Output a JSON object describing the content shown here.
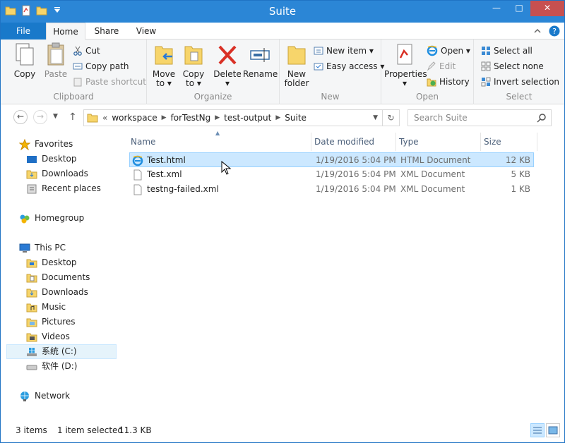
{
  "window": {
    "title": "Suite"
  },
  "tabs": {
    "file": "File",
    "home": "Home",
    "share": "Share",
    "view": "View"
  },
  "ribbon": {
    "clipboard": {
      "label": "Clipboard",
      "copy": "Copy",
      "paste": "Paste",
      "cut": "Cut",
      "copy_path": "Copy path",
      "paste_shortcut": "Paste shortcut"
    },
    "organize": {
      "label": "Organize",
      "move_to_1": "Move",
      "move_to_2": "to ▾",
      "copy_to_1": "Copy",
      "copy_to_2": "to ▾",
      "delete_1": "Delete",
      "delete_2": "▾",
      "rename": "Rename"
    },
    "new": {
      "label": "New",
      "new_folder_1": "New",
      "new_folder_2": "folder",
      "new_item": "New item ▾",
      "easy_access": "Easy access ▾"
    },
    "open": {
      "label": "Open",
      "properties_1": "Properties",
      "properties_2": "▾",
      "open": "Open ▾",
      "edit": "Edit",
      "history": "History"
    },
    "select": {
      "label": "Select",
      "select_all": "Select all",
      "select_none": "Select none",
      "invert": "Invert selection"
    }
  },
  "address": {
    "prefix": "«",
    "crumbs": [
      "workspace",
      "forTestNg",
      "test-output",
      "Suite"
    ],
    "search_placeholder": "Search Suite"
  },
  "nav": {
    "favorites": "Favorites",
    "fav_items": [
      "Desktop",
      "Downloads",
      "Recent places"
    ],
    "homegroup": "Homegroup",
    "thispc": "This PC",
    "pc_items": [
      "Desktop",
      "Documents",
      "Downloads",
      "Music",
      "Pictures",
      "Videos",
      "系统 (C:)",
      "软件 (D:)"
    ],
    "network": "Network"
  },
  "columns": {
    "name": "Name",
    "date": "Date modified",
    "type": "Type",
    "size": "Size"
  },
  "files": [
    {
      "name": "Test.html",
      "date": "1/19/2016 5:04 PM",
      "type": "HTML Document",
      "size": "12 KB"
    },
    {
      "name": "Test.xml",
      "date": "1/19/2016 5:04 PM",
      "type": "XML Document",
      "size": "5 KB"
    },
    {
      "name": "testng-failed.xml",
      "date": "1/19/2016 5:04 PM",
      "type": "XML Document",
      "size": "1 KB"
    }
  ],
  "status": {
    "items": "3 items",
    "selected": "1 item selected",
    "size": "11.3 KB"
  },
  "colors": {
    "titlebar": "#2b86d6",
    "file_tab": "#1979ca",
    "selection": "#cce8ff",
    "close": "#c75050"
  }
}
